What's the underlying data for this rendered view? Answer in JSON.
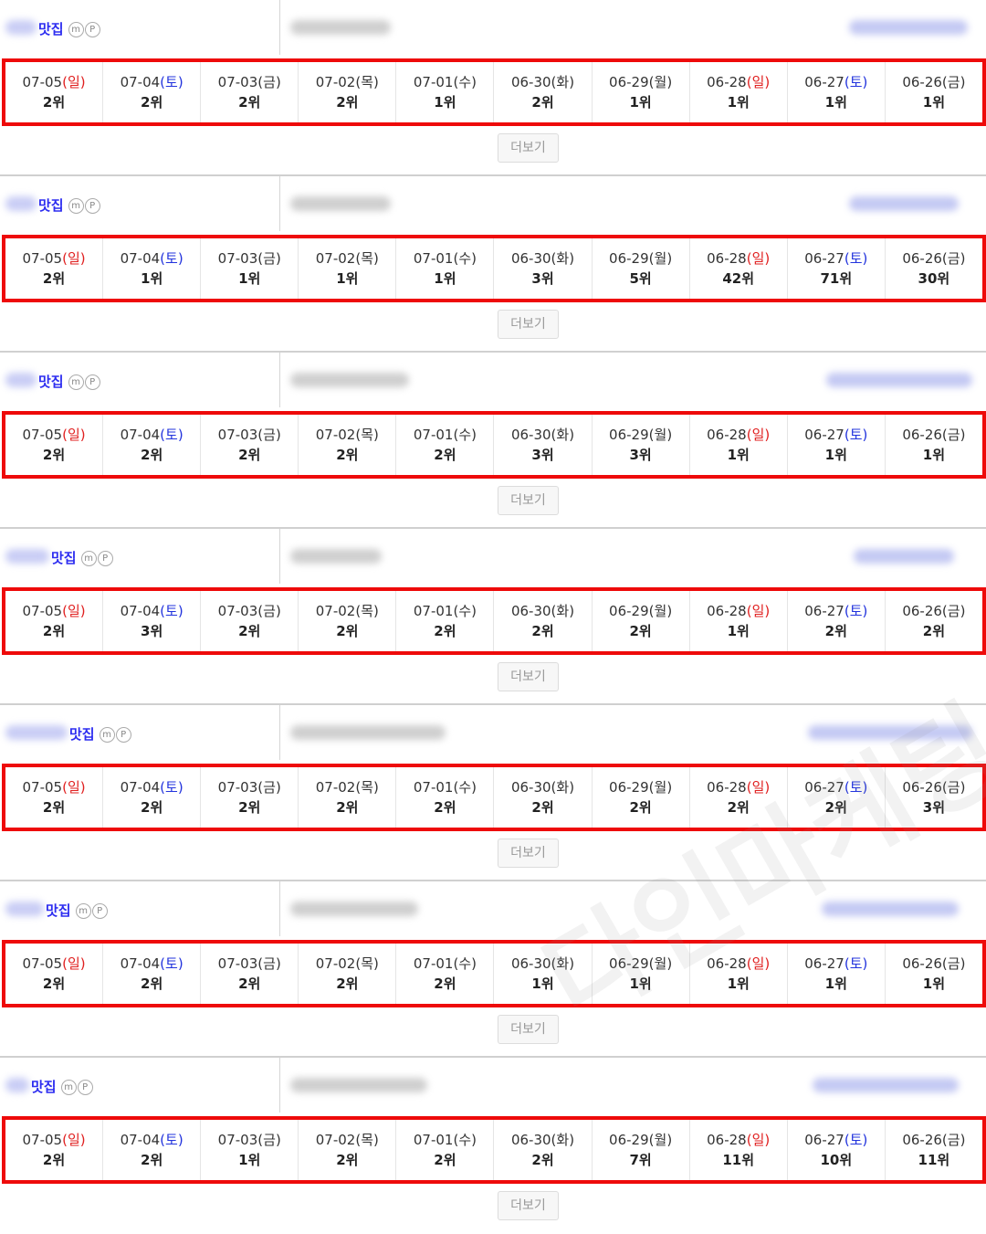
{
  "more_label": "더보기",
  "keyword_suffix": "맛집",
  "badge_m": "m",
  "badge_p": "P",
  "watermark": "다인마케팅",
  "colors": {
    "sunday": "#e02020",
    "saturday": "#2233dd",
    "highlight_border": "#ee0a0a",
    "keyword": "#2d2df0"
  },
  "dates": [
    {
      "md": "07-05",
      "open": "(",
      "day": "일",
      "close": ")",
      "type": "sun"
    },
    {
      "md": "07-04",
      "open": "(",
      "day": "토",
      "close": ")",
      "type": "sat"
    },
    {
      "md": "07-03",
      "open": "(",
      "day": "금",
      "close": ")",
      "type": "wk"
    },
    {
      "md": "07-02",
      "open": "(",
      "day": "목",
      "close": ")",
      "type": "wk"
    },
    {
      "md": "07-01",
      "open": "(",
      "day": "수",
      "close": ")",
      "type": "wk"
    },
    {
      "md": "06-30",
      "open": "(",
      "day": "화",
      "close": ")",
      "type": "wk"
    },
    {
      "md": "06-29",
      "open": "(",
      "day": "월",
      "close": ")",
      "type": "wk"
    },
    {
      "md": "06-28",
      "open": "(",
      "day": "일",
      "close": ")",
      "type": "sun"
    },
    {
      "md": "06-27",
      "open": "(",
      "day": "토",
      "close": ")",
      "type": "sat"
    },
    {
      "md": "06-26",
      "open": "(",
      "day": "금",
      "close": ")",
      "type": "wk"
    }
  ],
  "blocks": [
    {
      "ranks": [
        "2위",
        "2위",
        "2위",
        "2위",
        "1위",
        "2위",
        "1위",
        "1위",
        "1위",
        "1위"
      ]
    },
    {
      "ranks": [
        "2위",
        "1위",
        "1위",
        "1위",
        "1위",
        "3위",
        "5위",
        "42위",
        "71위",
        "30위"
      ]
    },
    {
      "ranks": [
        "2위",
        "2위",
        "2위",
        "2위",
        "2위",
        "3위",
        "3위",
        "1위",
        "1위",
        "1위"
      ]
    },
    {
      "ranks": [
        "2위",
        "3위",
        "2위",
        "2위",
        "2위",
        "2위",
        "2위",
        "1위",
        "2위",
        "2위"
      ]
    },
    {
      "ranks": [
        "2위",
        "2위",
        "2위",
        "2위",
        "2위",
        "2위",
        "2위",
        "2위",
        "2위",
        "3위"
      ]
    },
    {
      "ranks": [
        "2위",
        "2위",
        "2위",
        "2위",
        "2위",
        "1위",
        "1위",
        "1위",
        "1위",
        "1위"
      ]
    },
    {
      "ranks": [
        "2위",
        "2위",
        "1위",
        "2위",
        "2위",
        "2위",
        "7위",
        "11위",
        "10위",
        "11위"
      ]
    }
  ]
}
